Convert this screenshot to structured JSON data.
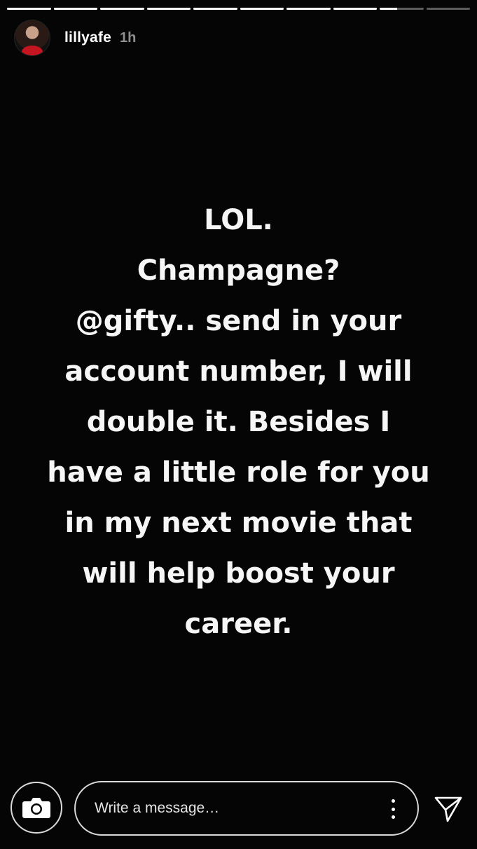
{
  "story": {
    "segments": [
      {
        "progress": 1
      },
      {
        "progress": 1
      },
      {
        "progress": 1
      },
      {
        "progress": 1
      },
      {
        "progress": 1
      },
      {
        "progress": 1
      },
      {
        "progress": 1
      },
      {
        "progress": 1
      },
      {
        "progress": 0.4
      },
      {
        "progress": 0
      }
    ],
    "username": "lillyafe",
    "time": "1h",
    "caption_lines": [
      "LOL.",
      "Champagne?",
      "@gifty.. send in your",
      "account number, I will",
      "double it. Besides I",
      "have a little role for you",
      "in my next movie that",
      "will help boost your",
      "career."
    ]
  },
  "footer": {
    "message_placeholder": "Write a message…",
    "camera_icon": "camera-icon",
    "more_icon": "more-vertical-icon",
    "send_icon": "send-icon"
  }
}
